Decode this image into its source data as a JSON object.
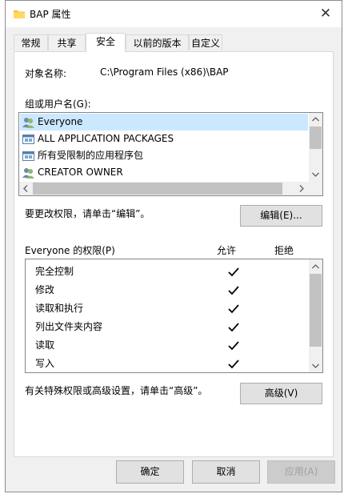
{
  "window": {
    "title": "BAP 属性",
    "close_glyph": "✕"
  },
  "tabs": [
    {
      "label": "常规"
    },
    {
      "label": "共享"
    },
    {
      "label": "安全"
    },
    {
      "label": "以前的版本"
    },
    {
      "label": "自定义"
    }
  ],
  "object": {
    "label": "对象名称:",
    "value": "C:\\Program Files (x86)\\BAP"
  },
  "groups": {
    "label": "组或用户名(G):",
    "items": [
      {
        "name": "Everyone",
        "icon": "users-group-icon"
      },
      {
        "name": "ALL APPLICATION PACKAGES",
        "icon": "app-package-icon"
      },
      {
        "name": "所有受限制的应用程序包",
        "icon": "app-package-icon"
      },
      {
        "name": "CREATOR OWNER",
        "icon": "users-group-icon"
      }
    ]
  },
  "change_hint": "要更改权限，请单击“编辑”。",
  "edit_button": "编辑(E)...",
  "permissions": {
    "title": "Everyone 的权限(P)",
    "allow_header": "允许",
    "deny_header": "拒绝",
    "rows": [
      {
        "name": "完全控制",
        "allow": true
      },
      {
        "name": "修改",
        "allow": true
      },
      {
        "name": "读取和执行",
        "allow": true
      },
      {
        "name": "列出文件夹内容",
        "allow": true
      },
      {
        "name": "读取",
        "allow": true
      },
      {
        "name": "写入",
        "allow": true
      }
    ]
  },
  "advanced_hint": "有关特殊权限或高级设置，请单击“高级”。",
  "advanced_button": "高级(V)",
  "footer": {
    "ok": "确定",
    "cancel": "取消",
    "apply": "应用(A)"
  },
  "colors": {
    "folder": "#f5c342",
    "scrollbar_thumb": "#c2c2c2",
    "active_tab_bg": "#ffffff"
  }
}
